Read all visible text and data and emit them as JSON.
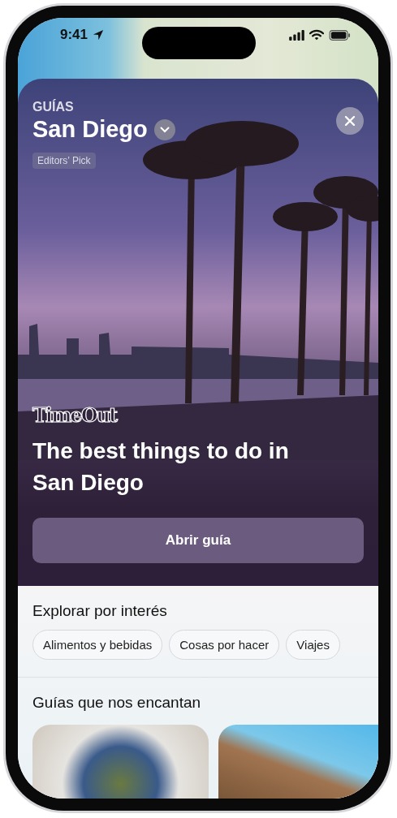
{
  "status_bar": {
    "time": "9:41"
  },
  "guide": {
    "section_label": "GUÍAS",
    "city": "San Diego",
    "badge": "Editors’ Pick",
    "publisher": "TimeOut",
    "title": "The best things to do in San Diego",
    "button": "Abrir guía"
  },
  "explore": {
    "title": "Explorar por interés",
    "chips": [
      "Alimentos y bebidas",
      "Cosas por hacer",
      "Viajes"
    ]
  },
  "featured": {
    "title": "Guías que nos encantan"
  }
}
